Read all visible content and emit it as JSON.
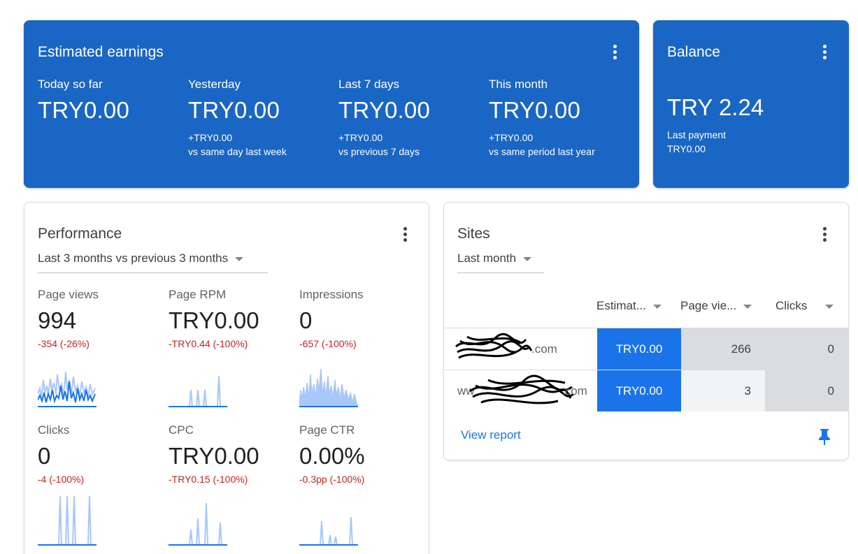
{
  "earnings": {
    "title": "Estimated earnings",
    "metrics": [
      {
        "label": "Today so far",
        "value": "TRY0.00",
        "delta": "",
        "compare": ""
      },
      {
        "label": "Yesterday",
        "value": "TRY0.00",
        "delta": "+TRY0.00",
        "compare": "vs same day last week"
      },
      {
        "label": "Last 7 days",
        "value": "TRY0.00",
        "delta": "+TRY0.00",
        "compare": "vs previous 7 days"
      },
      {
        "label": "This month",
        "value": "TRY0.00",
        "delta": "+TRY0.00",
        "compare": "vs same period last year"
      }
    ]
  },
  "balance": {
    "title": "Balance",
    "value": "TRY 2.24",
    "last_payment_label": "Last payment",
    "last_payment_value": "TRY0.00"
  },
  "performance": {
    "title": "Performance",
    "range": "Last 3 months vs previous 3 months",
    "metrics": [
      {
        "label": "Page views",
        "value": "994",
        "delta": "-354 (-26%)"
      },
      {
        "label": "Page RPM",
        "value": "TRY0.00",
        "delta": "-TRY0.44 (-100%)"
      },
      {
        "label": "Impressions",
        "value": "0",
        "delta": "-657 (-100%)"
      },
      {
        "label": "Clicks",
        "value": "0",
        "delta": "-4 (-100%)"
      },
      {
        "label": "CPC",
        "value": "TRY0.00",
        "delta": "-TRY0.15 (-100%)"
      },
      {
        "label": "Page CTR",
        "value": "0.00%",
        "delta": "-0.3pp (-100%)"
      }
    ]
  },
  "sites": {
    "title": "Sites",
    "range": "Last month",
    "columns": [
      "Estimat...",
      "Page vie...",
      "Clicks"
    ],
    "rows": [
      {
        "site_visible": ".com",
        "earnings": "TRY0.00",
        "page_views": "266",
        "clicks": "0"
      },
      {
        "site_visible_prefix": "ww",
        "site_visible": ".com",
        "earnings": "TRY0.00",
        "page_views": "3",
        "clicks": "0"
      }
    ],
    "view_report": "View report"
  },
  "icons": [
    "more-vert-icon",
    "dropdown-caret-icon",
    "pin-icon"
  ],
  "colors": {
    "accent_blue": "#1a66c5",
    "table_blue": "#1a73e8",
    "negative_red": "#c5221f",
    "spark_dark": "#1a73e8",
    "spark_light": "#a8c7fa"
  }
}
